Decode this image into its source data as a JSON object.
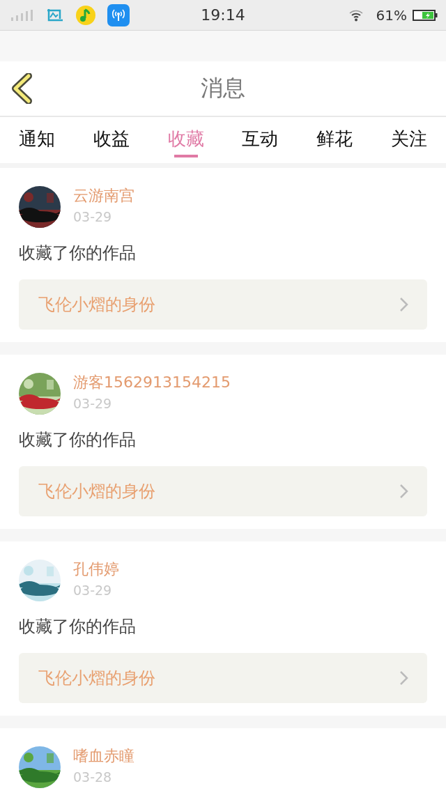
{
  "status_bar": {
    "time": "19:14",
    "battery": "61%"
  },
  "header": {
    "title": "消息"
  },
  "tabs": [
    {
      "label": "通知",
      "selected": false
    },
    {
      "label": "收益",
      "selected": false
    },
    {
      "label": "收藏",
      "selected": true
    },
    {
      "label": "互动",
      "selected": false
    },
    {
      "label": "鲜花",
      "selected": false
    },
    {
      "label": "关注",
      "selected": false
    }
  ],
  "messages": [
    {
      "user": "云游南宫",
      "date": "03-29",
      "action": "收藏了你的作品",
      "work": "飞伦小熠的身份"
    },
    {
      "user": "游客1562913154215",
      "date": "03-29",
      "action": "收藏了你的作品",
      "work": "飞伦小熠的身份"
    },
    {
      "user": "孔伟婷",
      "date": "03-29",
      "action": "收藏了你的作品",
      "work": "飞伦小熠的身份"
    },
    {
      "user": "嗜血赤瞳",
      "date": "03-28"
    }
  ]
}
